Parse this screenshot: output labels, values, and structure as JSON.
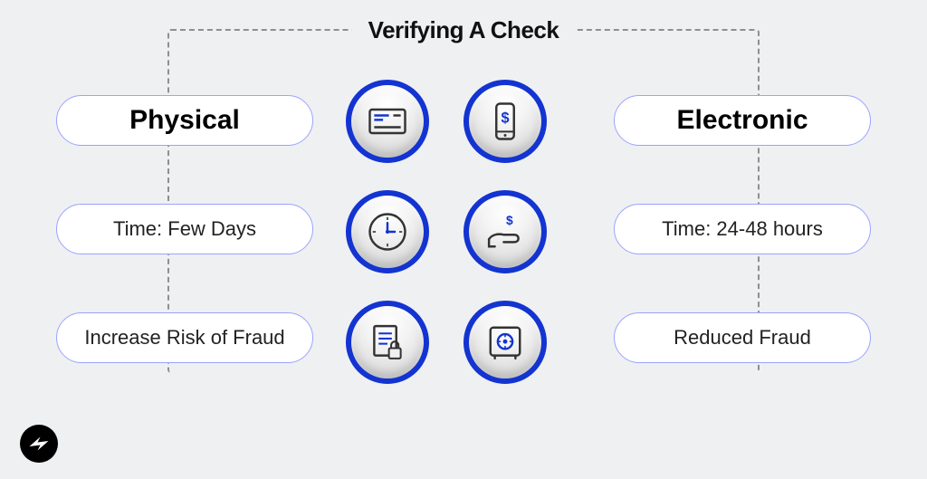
{
  "title": "Verifying A Check",
  "left": {
    "header": "Physical",
    "time": "Time: Few Days",
    "fraud": "Increase Risk of Fraud",
    "icons": [
      "check-card-icon",
      "clock-icon",
      "document-lock-icon"
    ]
  },
  "right": {
    "header": "Electronic",
    "time": "Time: 24-48 hours",
    "fraud": "Reduced Fraud",
    "icons": [
      "phone-dollar-icon",
      "hand-dollar-icon",
      "safe-icon"
    ]
  },
  "colors": {
    "accent": "#1334d1",
    "stroke": "#333333"
  }
}
